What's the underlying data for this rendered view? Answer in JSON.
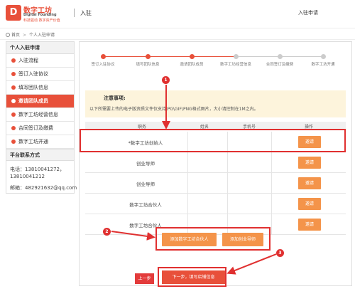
{
  "header": {
    "logo_glyph": "D",
    "brand_name": "数字工坊",
    "brand_en": "Digital Founding",
    "brand_slogan": "科技驱动 数字资产价值",
    "page_heading": "入驻",
    "right_link": "入驻申请"
  },
  "breadcrumb": {
    "home": "首页",
    "current": "个人入驻申请"
  },
  "sidebar": {
    "heading": "个人入驻申请",
    "items": [
      {
        "label": "入驻流程",
        "active": false
      },
      {
        "label": "签订入驻协议",
        "active": false
      },
      {
        "label": "填写团队信息",
        "active": false
      },
      {
        "label": "邀请团队成员",
        "active": true
      },
      {
        "label": "数字工坊经营信息",
        "active": false
      },
      {
        "label": "合同签订及缴费",
        "active": false
      },
      {
        "label": "数字工坊开通",
        "active": false
      }
    ],
    "contact_heading": "平台联系方式",
    "phone_line1": "电话：13810041272，",
    "phone_line2": "13810041212",
    "email_line": "邮箱：482921632@qq.com"
  },
  "steps": [
    {
      "label": "签订入驻协议",
      "done": true
    },
    {
      "label": "填写团队信息",
      "done": true
    },
    {
      "label": "邀请团队成员",
      "done": true
    },
    {
      "label": "数字工坊经营信息",
      "done": false
    },
    {
      "label": "合同签订及缴费",
      "done": false
    },
    {
      "label": "数字工坊开通",
      "done": false
    }
  ],
  "notice": {
    "title": "注意事项:",
    "text": "以下所需要上传的电子版资质文件仅支持JPG\\GIF\\PNG格式图片，大小请控制在1M之内。"
  },
  "table": {
    "headers": [
      "职务",
      "姓名",
      "手机号",
      "操作"
    ],
    "rows": [
      {
        "role": "*数字工坊创始人",
        "action": "邀请"
      },
      {
        "role": "创业导师",
        "action": "邀请"
      },
      {
        "role": "创业导师",
        "action": "邀请"
      },
      {
        "role": "数字工坊合伙人",
        "action": "邀请"
      },
      {
        "role": "数字工坊合伙人",
        "action": "邀请"
      }
    ]
  },
  "buttons": {
    "add_partner": "添加数字工坊合伙人",
    "add_mentor": "添加创业导师",
    "prev": "上一步",
    "next": "下一步，填写店铺信息"
  },
  "badges": [
    "1",
    "2",
    "3"
  ],
  "colors": {
    "accent": "#e8503a",
    "button_orange": "#f4944a",
    "callout_red": "#e03030",
    "notice_bg": "#fdf4dc"
  }
}
